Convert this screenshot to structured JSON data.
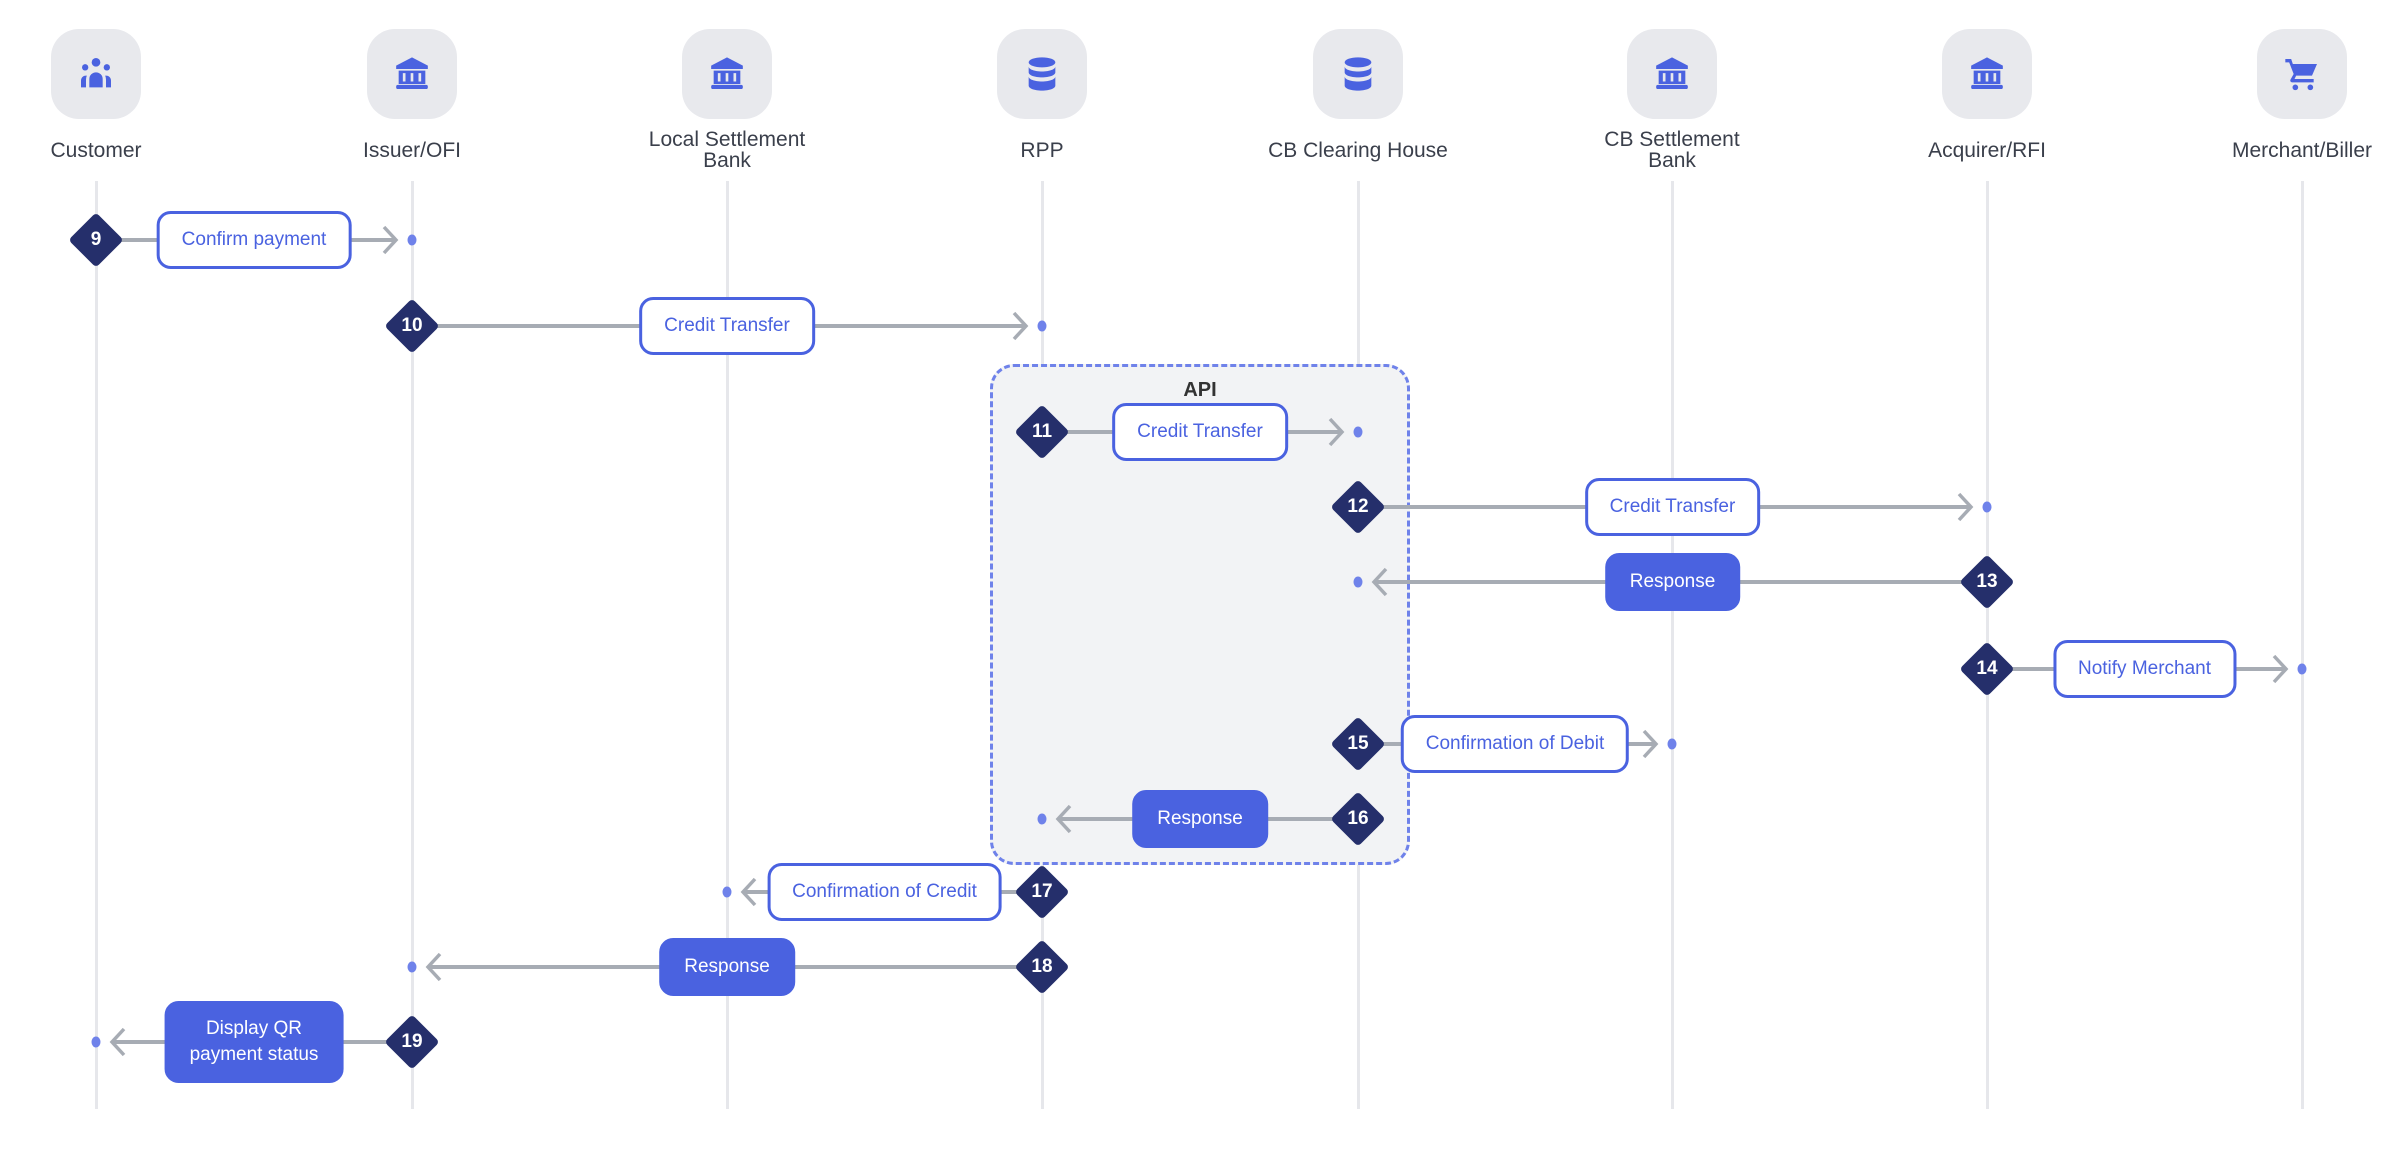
{
  "colors": {
    "accent": "#4a62e0",
    "step_marker": "#252f6b",
    "connector": "#a7acb4",
    "endpoint_dot": "#6f82ea",
    "icon_bg": "#e8e9ed",
    "api_region_bg": "#f2f3f5"
  },
  "participants": [
    {
      "id": "customer",
      "label": "Customer",
      "icon": "users-icon"
    },
    {
      "id": "issuer",
      "label": "Issuer/OFI",
      "icon": "bank-icon"
    },
    {
      "id": "local_settlement",
      "label": "Local Settlement\nBank",
      "icon": "bank-icon"
    },
    {
      "id": "rpp",
      "label": "RPP",
      "icon": "database-icon"
    },
    {
      "id": "cb_clearing",
      "label": "CB Clearing House",
      "icon": "database-icon"
    },
    {
      "id": "cb_settlement",
      "label": "CB Settlement\nBank",
      "icon": "bank-icon"
    },
    {
      "id": "acquirer",
      "label": "Acquirer/RFI",
      "icon": "bank-icon"
    },
    {
      "id": "merchant",
      "label": "Merchant/Biller",
      "icon": "cart-icon"
    }
  ],
  "api_region": {
    "label": "API"
  },
  "steps": [
    {
      "number": "9",
      "label": "Confirm payment",
      "from": 0,
      "to": 1,
      "style": "outline"
    },
    {
      "number": "10",
      "label": "Credit Transfer",
      "from": 1,
      "to": 3,
      "style": "outline"
    },
    {
      "number": "11",
      "label": "Credit Transfer",
      "from": 3,
      "to": 4,
      "style": "outline"
    },
    {
      "number": "12",
      "label": "Credit Transfer",
      "from": 4,
      "to": 6,
      "style": "outline"
    },
    {
      "number": "13",
      "label": "Response",
      "from": 6,
      "to": 4,
      "style": "filled"
    },
    {
      "number": "14",
      "label": "Notify Merchant",
      "from": 6,
      "to": 7,
      "style": "outline"
    },
    {
      "number": "15",
      "label": "Confirmation of Debit",
      "from": 4,
      "to": 5,
      "style": "outline"
    },
    {
      "number": "16",
      "label": "Response",
      "from": 4,
      "to": 3,
      "style": "filled"
    },
    {
      "number": "17",
      "label": "Confirmation of Credit",
      "from": 3,
      "to": 2,
      "style": "outline"
    },
    {
      "number": "18",
      "label": "Response",
      "from": 3,
      "to": 1,
      "style": "filled"
    },
    {
      "number": "19",
      "label": "Display QR\npayment status",
      "from": 1,
      "to": 0,
      "style": "filled"
    }
  ]
}
